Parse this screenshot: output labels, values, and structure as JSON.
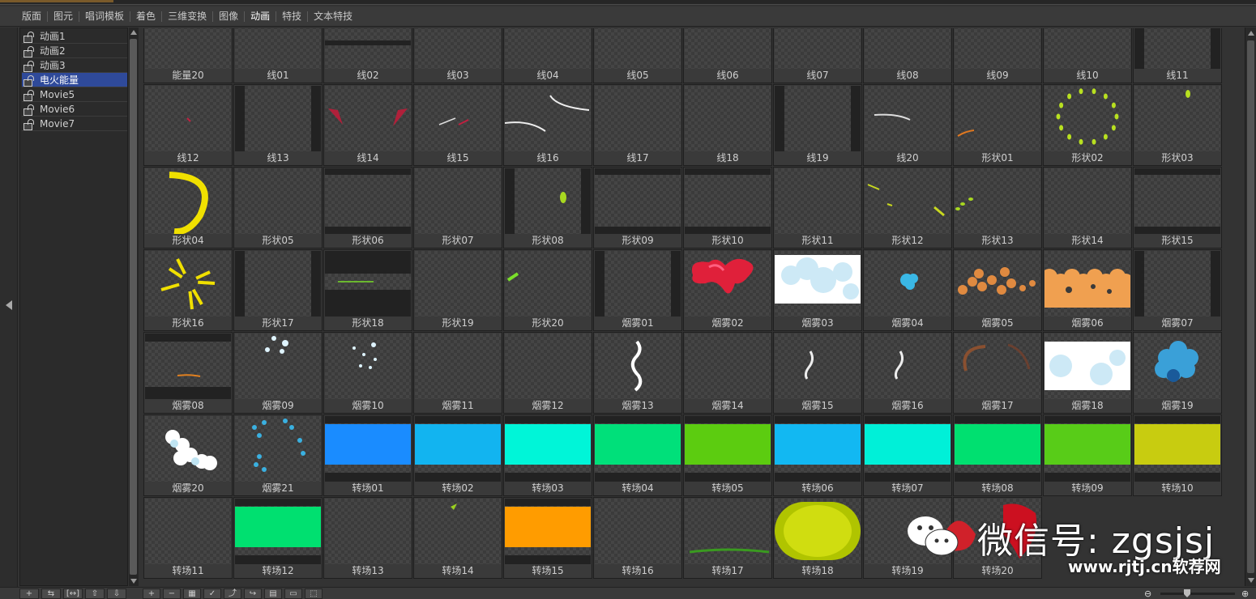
{
  "tabs": [
    "版面",
    "图元",
    "唱词模板",
    "着色",
    "三维变换",
    "图像",
    "动画",
    "特技",
    "文本特技"
  ],
  "active_tab": "动画",
  "movies": [
    {
      "label": "动画1",
      "selected": false
    },
    {
      "label": "动画2",
      "selected": false
    },
    {
      "label": "动画3",
      "selected": false
    },
    {
      "label": "电火能量",
      "selected": true
    },
    {
      "label": "Movie5",
      "selected": false
    },
    {
      "label": "Movie6",
      "selected": false
    },
    {
      "label": "Movie7",
      "selected": false
    }
  ],
  "items": [
    {
      "label": "能量20",
      "art": "energy"
    },
    {
      "label": "线01",
      "art": "none"
    },
    {
      "label": "线02",
      "art": "hbar_bottom"
    },
    {
      "label": "线03",
      "art": "none"
    },
    {
      "label": "线04",
      "art": "none"
    },
    {
      "label": "线05",
      "art": "none"
    },
    {
      "label": "线06",
      "art": "red_blob_small"
    },
    {
      "label": "线07",
      "art": "none"
    },
    {
      "label": "线08",
      "art": "none"
    },
    {
      "label": "线09",
      "art": "white_dash"
    },
    {
      "label": "线10",
      "art": "none"
    },
    {
      "label": "线11",
      "art": "side_bars"
    },
    {
      "label": "线12",
      "art": "tiny_red"
    },
    {
      "label": "线13",
      "art": "side_bars"
    },
    {
      "label": "线14",
      "art": "red_wings"
    },
    {
      "label": "线15",
      "art": "small_lines"
    },
    {
      "label": "线16",
      "art": "white_curves"
    },
    {
      "label": "线17",
      "art": "none"
    },
    {
      "label": "线18",
      "art": "none"
    },
    {
      "label": "线19",
      "art": "side_bars"
    },
    {
      "label": "线20",
      "art": "white_curve"
    },
    {
      "label": "形状01",
      "art": "orange_dash"
    },
    {
      "label": "形状02",
      "art": "yellow_ring_dots"
    },
    {
      "label": "形状03",
      "art": "yellow_dot"
    },
    {
      "label": "形状04",
      "art": "yellow_arc"
    },
    {
      "label": "形状05",
      "art": "none"
    },
    {
      "label": "形状06",
      "art": "hbars"
    },
    {
      "label": "形状07",
      "art": "none"
    },
    {
      "label": "形状08",
      "art": "side_bars_dot"
    },
    {
      "label": "形状09",
      "art": "hbars"
    },
    {
      "label": "形状10",
      "art": "hbars"
    },
    {
      "label": "形状11",
      "art": "none"
    },
    {
      "label": "形状12",
      "art": "yellow_dashes"
    },
    {
      "label": "形状13",
      "art": "yellow_dashes2"
    },
    {
      "label": "形状14",
      "art": "none"
    },
    {
      "label": "形状15",
      "art": "hbars"
    },
    {
      "label": "形状16",
      "art": "yellow_star"
    },
    {
      "label": "形状17",
      "art": "side_bars"
    },
    {
      "label": "形状18",
      "art": "dark_bands"
    },
    {
      "label": "形状19",
      "art": "none"
    },
    {
      "label": "形状20",
      "art": "green_dash"
    },
    {
      "label": "烟雾01",
      "art": "side_bars"
    },
    {
      "label": "烟雾02",
      "art": "red_cloud"
    },
    {
      "label": "烟雾03",
      "art": "white_cloud"
    },
    {
      "label": "烟雾04",
      "art": "blue_puff"
    },
    {
      "label": "烟雾05",
      "art": "orange_dust"
    },
    {
      "label": "烟雾06",
      "art": "orange_cloud"
    },
    {
      "label": "烟雾07",
      "art": "side_bars"
    },
    {
      "label": "烟雾08",
      "art": "hbars_orange"
    },
    {
      "label": "烟雾09",
      "art": "white_spots"
    },
    {
      "label": "烟雾10",
      "art": "white_spots2"
    },
    {
      "label": "烟雾11",
      "art": "none"
    },
    {
      "label": "烟雾12",
      "art": "none"
    },
    {
      "label": "烟雾13",
      "art": "white_smoke"
    },
    {
      "label": "烟雾14",
      "art": "none"
    },
    {
      "label": "烟雾15",
      "art": "white_wisp"
    },
    {
      "label": "烟雾16",
      "art": "white_wisp"
    },
    {
      "label": "烟雾17",
      "art": "brown_swirl"
    },
    {
      "label": "烟雾18",
      "art": "white_cloud_big"
    },
    {
      "label": "烟雾19",
      "art": "blue_cloud"
    },
    {
      "label": "烟雾20",
      "art": "white_puff"
    },
    {
      "label": "烟雾21",
      "art": "blue_spots"
    },
    {
      "label": "转场01",
      "art": "fill",
      "color": "#1a8cff"
    },
    {
      "label": "转场02",
      "art": "fill",
      "color": "#12b4f0"
    },
    {
      "label": "转场03",
      "art": "fill",
      "color": "#00f5d8"
    },
    {
      "label": "转场04",
      "art": "fill",
      "color": "#00e07a"
    },
    {
      "label": "转场05",
      "art": "fill",
      "color": "#5ccc10"
    },
    {
      "label": "转场06",
      "art": "fill",
      "color": "#12b8f2"
    },
    {
      "label": "转场07",
      "art": "fill",
      "color": "#00f0d8"
    },
    {
      "label": "转场08",
      "art": "fill",
      "color": "#00e070"
    },
    {
      "label": "转场09",
      "art": "fill",
      "color": "#58cc18"
    },
    {
      "label": "转场10",
      "art": "fill",
      "color": "#c8cc10"
    },
    {
      "label": "转场11",
      "art": "none"
    },
    {
      "label": "转场12",
      "art": "fill",
      "color": "#00e070"
    },
    {
      "label": "转场13",
      "art": "none"
    },
    {
      "label": "转场14",
      "art": "green_tick"
    },
    {
      "label": "转场15",
      "art": "fill",
      "color": "#ff9c00"
    },
    {
      "label": "转场16",
      "art": "none"
    },
    {
      "label": "转场17",
      "art": "green_line"
    },
    {
      "label": "转场18",
      "art": "yellow_ellipse"
    },
    {
      "label": "转场19",
      "art": "none"
    },
    {
      "label": "转场20",
      "art": "red_splash"
    }
  ],
  "watermark": {
    "text": "微信号: zgsjsj",
    "url": "www.rjtj.cn软荐网"
  },
  "bottom_buttons": [
    "plus",
    "minus",
    "grid",
    "check",
    "export",
    "import",
    "export2",
    "monitor",
    "frame"
  ],
  "left_bottom_buttons": [
    "add",
    "link",
    "fit",
    "up",
    "down"
  ]
}
